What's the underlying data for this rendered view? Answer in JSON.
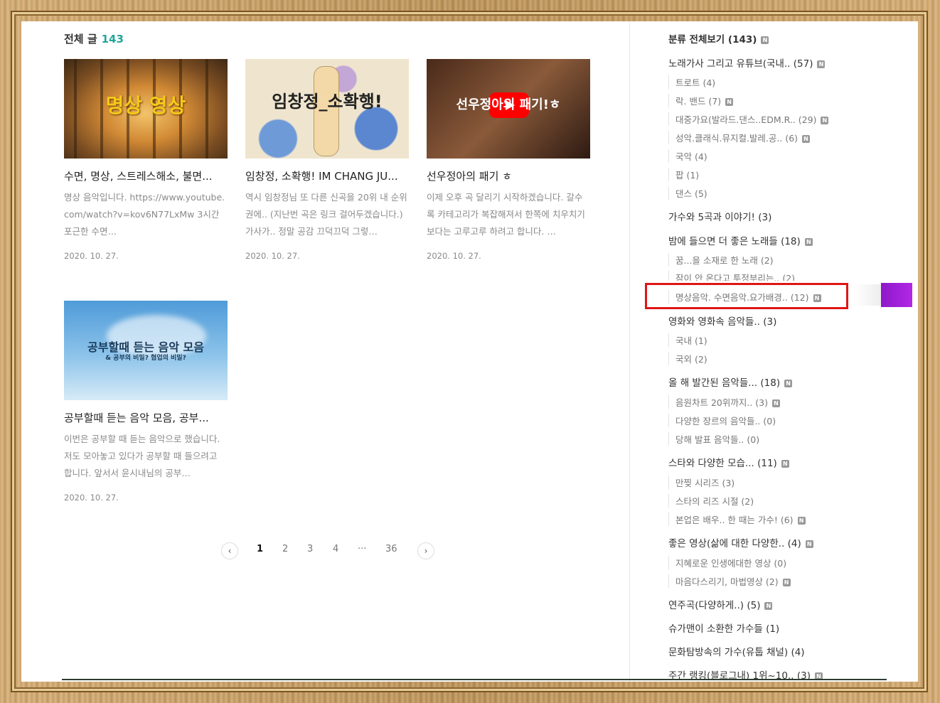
{
  "main": {
    "heading": "전체 글",
    "count": "143",
    "posts": [
      {
        "thumb_caption": "명상 영상",
        "title": "수면, 명상, 스트레스해소, 불면...",
        "excerpt": "명상 음악입니다. https://www.youtube.com/watch?v=kov6N77LxMw 3시간 포근한 수면…",
        "date": "2020. 10. 27."
      },
      {
        "thumb_caption": "임창정_소확행!",
        "title": "임창정, 소확행! IM CHANG JU...",
        "excerpt": "역시 임창정님 또 다른 신곡을 20위 내 순위권에.. (지난번 곡은 링크 걸어두겠습니다.) 가사가.. 정말 공감 끄덕끄덕 그렇…",
        "date": "2020. 10. 27."
      },
      {
        "thumb_caption": "선우정아의 패기!ㅎ",
        "title": "선우정아의 패기 ㅎ",
        "excerpt": "이제 오후 곡 달리기 시작하겠습니다. 갈수록 카테고리가 복잡해져서 한쪽에 치우치기보다는 고루고루 하려고 합니다. …",
        "date": "2020. 10. 27."
      },
      {
        "thumb_caption": "공부할때 듣는 음악 모음",
        "thumb_caption_small": "& 공부의 비밀? 협업의 비밀?",
        "title": "공부할때 듣는 음악 모음, 공부...",
        "excerpt": "이번은 공부할 때 듣는 음악으로 했습니다. 저도 모아놓고 있다가 공부할 때 들으려고 합니다. 앞서서 윤시내님의 공부…",
        "date": "2020. 10. 27."
      }
    ],
    "pager": {
      "prev": "‹",
      "pages": [
        "1",
        "2",
        "3",
        "4",
        "···",
        "36"
      ],
      "next": "›"
    }
  },
  "sidebar": {
    "head": "분류 전체보기 (143)",
    "badge": "N",
    "items": [
      {
        "label": "노래가사 그리고 유튜브(국내.. (57)",
        "new": true
      },
      {
        "label": "트로트 (4)",
        "new": false
      },
      {
        "label": "락. 밴드 (7)",
        "new": true
      },
      {
        "label": "대중가요(발라드.댄스..EDM.R.. (29)",
        "new": true
      },
      {
        "label": "성악.클래식.뮤지컬.발레.공.. (6)",
        "new": true
      },
      {
        "label": "국악 (4)",
        "new": false
      },
      {
        "label": "팝 (1)",
        "new": false
      },
      {
        "label": "댄스 (5)",
        "new": false
      },
      {
        "label": "가수와 5곡과 이야기! (3)",
        "new": false
      },
      {
        "label": "밤에 들으면 더 좋은 노래들 (18)",
        "new": true
      },
      {
        "label": "꿈...을 소재로 한 노래 (2)",
        "new": false
      },
      {
        "label": "잠이 안 온다고 투정부리는.. (2)",
        "new": false
      },
      {
        "label": "명상음악. 수면음악.요가배경.. (12)",
        "new": true
      },
      {
        "label": "영화와 영화속 음악들.. (3)",
        "new": false
      },
      {
        "label": "국내 (1)",
        "new": false
      },
      {
        "label": "국외 (2)",
        "new": false
      },
      {
        "label": "올 해 발간된 음악들... (18)",
        "new": true
      },
      {
        "label": "음원차트 20위까지.. (3)",
        "new": true
      },
      {
        "label": "다양한 장르의 음악들.. (0)",
        "new": false
      },
      {
        "label": "당해 발표 음악들.. (0)",
        "new": false
      },
      {
        "label": "스타와 다양한 모습... (11)",
        "new": true
      },
      {
        "label": "만찢 시리즈 (3)",
        "new": false
      },
      {
        "label": "스타의 리즈 시절 (2)",
        "new": false
      },
      {
        "label": "본업은 배우.. 한 때는 가수! (6)",
        "new": true
      },
      {
        "label": "좋은 영상(삶에 대한 다양한.. (4)",
        "new": true
      },
      {
        "label": "지혜로운 인생에대한 영상 (0)",
        "new": false
      },
      {
        "label": "마음다스리기, 마법영상 (2)",
        "new": true
      },
      {
        "label": "연주곡(다양하게..) (5)",
        "new": true
      },
      {
        "label": "슈가맨이 소환한 가수들 (1)",
        "new": false
      },
      {
        "label": "문화탐방속의 가수(유툽 채널) (4)",
        "new": false
      },
      {
        "label": "주간 랭킹(블로그내) 1위~10.. (3)",
        "new": true
      }
    ]
  }
}
